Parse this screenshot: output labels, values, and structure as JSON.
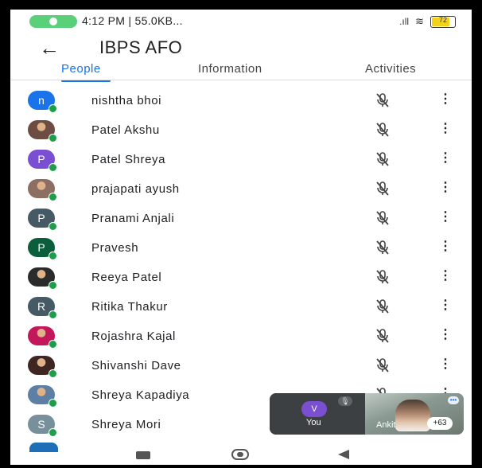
{
  "status_bar": {
    "text": "4:12 PM | 55.0KB...",
    "battery": "72"
  },
  "header": {
    "back_icon": "←",
    "title": "IBPS AFO"
  },
  "tabs": [
    {
      "label": "People",
      "active": true
    },
    {
      "label": "Information",
      "active": false
    },
    {
      "label": "Activities",
      "active": false
    }
  ],
  "people": [
    {
      "name": "nishtha bhoi",
      "initial": "n",
      "avatar_color": "#1a73e8",
      "photo": false
    },
    {
      "name": "Patel Akshu",
      "initial": "",
      "avatar_color": "#6d4c41",
      "photo": true
    },
    {
      "name": "Patel Shreya",
      "initial": "P",
      "avatar_color": "#7b4fd1",
      "photo": false
    },
    {
      "name": "prajapati ayush",
      "initial": "",
      "avatar_color": "#8d6e63",
      "photo": true
    },
    {
      "name": "Pranami Anjali",
      "initial": "P",
      "avatar_color": "#455a64",
      "photo": false
    },
    {
      "name": "Pravesh",
      "initial": "P",
      "avatar_color": "#0b5e3c",
      "photo": false
    },
    {
      "name": "Reeya Patel",
      "initial": "",
      "avatar_color": "#2b2b2b",
      "photo": true
    },
    {
      "name": "Ritika Thakur",
      "initial": "R",
      "avatar_color": "#455a64",
      "photo": false
    },
    {
      "name": "Rojashra Kajal",
      "initial": "",
      "avatar_color": "#c2185b",
      "photo": true
    },
    {
      "name": "Shivanshi Dave",
      "initial": "",
      "avatar_color": "#3e2723",
      "photo": true
    },
    {
      "name": "Shreya Kapadiya",
      "initial": "",
      "avatar_color": "#5c7fa3",
      "photo": true
    },
    {
      "name": "Shreya Mori",
      "initial": "S",
      "avatar_color": "#78909c",
      "photo": false
    }
  ],
  "video_tiles": {
    "you": {
      "initial": "V",
      "label": "You"
    },
    "other": {
      "label": "Ankit",
      "more_count": "+63"
    }
  },
  "icons": {
    "back": "arrow-left-icon",
    "mute": "mic-off-icon",
    "more": "more-vert-icon"
  }
}
